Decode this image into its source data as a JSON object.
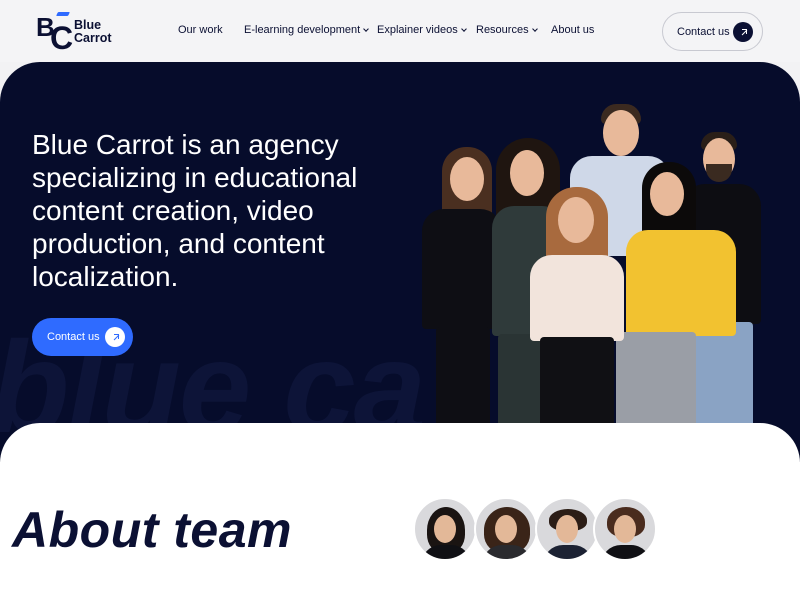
{
  "brand": {
    "logo_letters": "BC",
    "name_line1": "Blue",
    "name_line2": "Carrot",
    "accent_color": "#2f6bff",
    "navy_color": "#0b1033"
  },
  "nav": {
    "items": [
      {
        "label": "Our work",
        "dropdown": false
      },
      {
        "label": "E-learning development",
        "dropdown": true
      },
      {
        "label": "Explainer videos",
        "dropdown": true
      },
      {
        "label": "Resources",
        "dropdown": true
      },
      {
        "label": "About us",
        "dropdown": false
      }
    ],
    "contact_label": "Contact us"
  },
  "hero": {
    "headline": "Blue Carrot is an agency specializing in educational content creation, video production, and content localization.",
    "cta_label": "Contact us",
    "watermark": "blue ca",
    "background_color": "#060c2b"
  },
  "about": {
    "title": "About team",
    "avatar_count": 4
  }
}
